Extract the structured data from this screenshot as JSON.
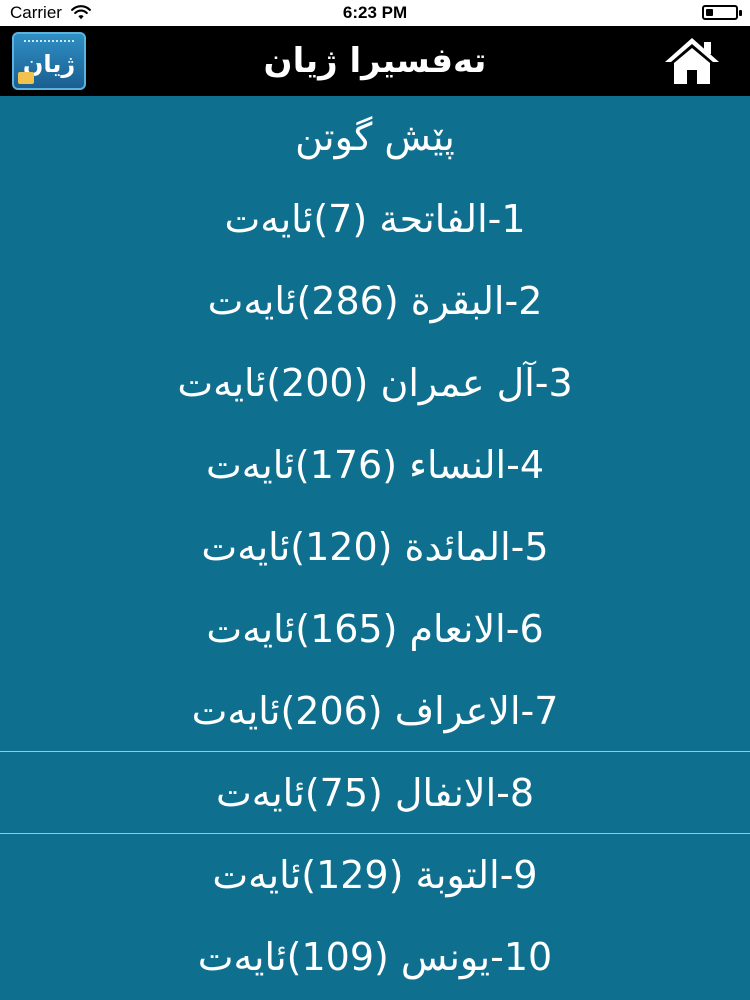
{
  "status_bar": {
    "carrier": "Carrier",
    "time": "6:23 PM",
    "battery_level": 0.25
  },
  "header": {
    "logo_text": "ژیان",
    "title": "تەفسیرا ژیان",
    "home_icon": "home-icon"
  },
  "colors": {
    "background": "#0f6f8f",
    "header": "#000000",
    "text": "#ffffff",
    "separator": "#9fc7d6"
  },
  "chapters": [
    {
      "label": "پێش گوتن"
    },
    {
      "label": "1-الفاتحة (7)ئایەت"
    },
    {
      "label": "2-البقرة (286)ئایەت"
    },
    {
      "label": "3-آل عمران (200)ئایەت"
    },
    {
      "label": "4-النساء (176)ئایەت"
    },
    {
      "label": "5-المائدة (120)ئایەت"
    },
    {
      "label": "6-الانعام (165)ئایەت"
    },
    {
      "label": "7-الاعراف (206)ئایەت"
    },
    {
      "label": "8-الانفال (75)ئایەت"
    },
    {
      "label": "9-التوبة (129)ئایەت"
    },
    {
      "label": "10-یونس (109)ئایەت"
    }
  ]
}
